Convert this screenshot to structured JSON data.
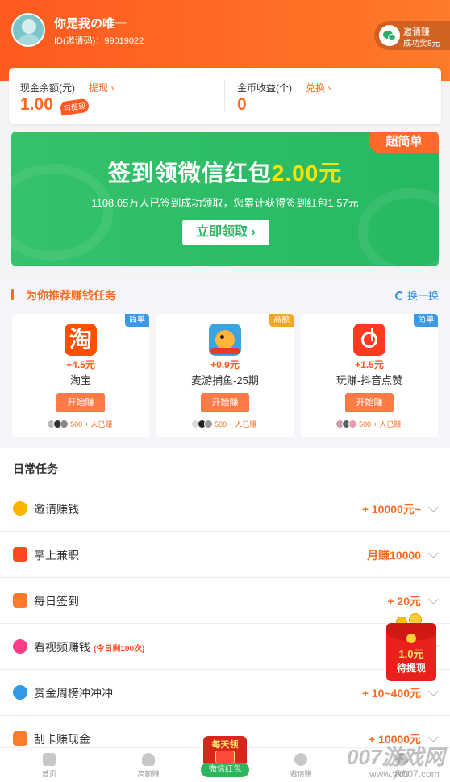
{
  "header": {
    "user_name": "你是我の唯一",
    "user_id": "ID(邀请码)：99019022",
    "invite_title": "邀请赚",
    "invite_sub": "成功奖8元"
  },
  "balance": {
    "cash_label": "现金余额(元)",
    "cash_action": "提现 ›",
    "cash_value": "1.00",
    "cash_badge": "可提现",
    "coin_label": "金币收益(个)",
    "coin_action": "兑换 ›",
    "coin_value": "0"
  },
  "banner": {
    "tag": "超简单",
    "title_prefix": "签到领微信红包",
    "title_amount": "2.00元",
    "subtitle": "1108.05万人已签到成功领取，您累计获得签到红包1.57元",
    "button": "立即领取 ›"
  },
  "recommend": {
    "title": "为你推荐赚钱任务",
    "refresh": "换一换",
    "tasks": [
      {
        "tag": "简单",
        "tag_color": "#3a9ae8",
        "icon_text": "淘",
        "icon_color": "#ff5000",
        "reward": "+4.5元",
        "name": "淘宝",
        "button": "开始赚",
        "users": "500 + 人已赚"
      },
      {
        "tag": "高额",
        "tag_color": "#f5a623",
        "icon_text": "",
        "icon_color": "#3aa3e0",
        "reward": "+0.9元",
        "name": "麦游捕鱼-25期",
        "button": "开始赚",
        "users": "500 + 人已赚"
      },
      {
        "tag": "简单",
        "tag_color": "#3a9ae8",
        "icon_text": "",
        "icon_color": "#ff3b1f",
        "reward": "+1.5元",
        "name": "玩赚-抖音点赞",
        "button": "开始赚",
        "users": "500 + 人已赚"
      }
    ]
  },
  "daily": {
    "title": "日常任务",
    "items": [
      {
        "label": "邀请赚钱",
        "sub": "",
        "reward": "+ 10000元~",
        "icon": "users-icon",
        "icon_color": "#ffb300"
      },
      {
        "label": "掌上兼职",
        "sub": "",
        "reward": "月赚10000",
        "icon": "red-packet-icon",
        "icon_color": "#ff4a1f"
      },
      {
        "label": "每日签到",
        "sub": "",
        "reward": "+ 20元",
        "icon": "calendar-icon",
        "icon_color": "#ff7a2a"
      },
      {
        "label": "看视频赚钱",
        "sub": "(今日剩100次)",
        "reward": "",
        "icon": "play-icon",
        "icon_color": "#ff3b8a"
      },
      {
        "label": "赏金周榜冲冲冲",
        "sub": "",
        "reward": "+ 10~400元",
        "icon": "medal-icon",
        "icon_color": "#2f9be8"
      },
      {
        "label": "刮卡赚现金",
        "sub": "",
        "reward": "+ 10000元",
        "icon": "gift-icon",
        "icon_color": "#ff7a2a"
      }
    ]
  },
  "float_envelope": {
    "amount": "1.0元",
    "label": "待提现"
  },
  "bottom_nav": {
    "items": [
      "首页",
      "高额赚",
      "邀请赚",
      "我的"
    ],
    "center_top": "每天领",
    "center_label": "微信红包"
  },
  "watermark": {
    "line1": "007游戏网",
    "line2": "www.yx007.com"
  }
}
